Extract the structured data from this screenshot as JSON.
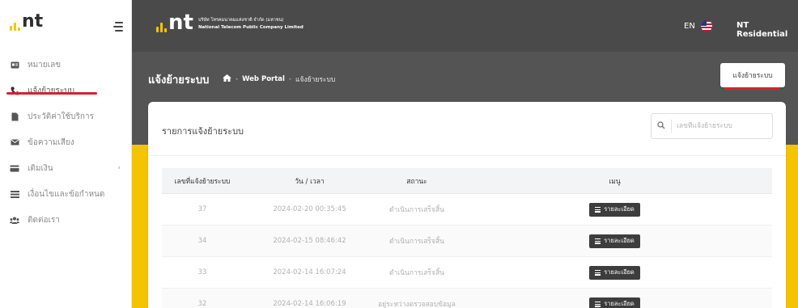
{
  "sidebar": {
    "logo_text": "nt",
    "items": [
      {
        "label": "หมายเลข",
        "icon": "id-card-icon"
      },
      {
        "label": "แจ้งย้ายระบบ",
        "icon": "phone-icon",
        "active": true
      },
      {
        "label": "ประวัติค่าใช้บริการ",
        "icon": "file-icon"
      },
      {
        "label": "ข้อความเสียง",
        "icon": "envelope-icon"
      },
      {
        "label": "เติมเงิน",
        "icon": "credit-card-icon",
        "has_submenu": true
      },
      {
        "label": "เงื่อนไขและข้อกำหนด",
        "icon": "list-icon"
      },
      {
        "label": "ติดต่อเรา",
        "icon": "users-icon"
      }
    ]
  },
  "header": {
    "brand_nt": "nt",
    "brand_th": "บริษัท โทรคมนาคมแห่งชาติ จำกัด (มหาชน)",
    "brand_en": "National Telecom Public Company Limited",
    "lang": "EN",
    "user": "NT Residential"
  },
  "banner": {
    "title": "แจ้งย้ายระบบ",
    "breadcrumb": {
      "sep": "-",
      "portal": "Web Portal",
      "current": "แจ้งย้ายระบบ"
    },
    "action_button": "แจ้งย้ายระบบ"
  },
  "card": {
    "title": "รายการแจ้งย้ายระบบ",
    "search_placeholder": "เลขที่แจ้งย้ายระบบ"
  },
  "table": {
    "headers": [
      "เลขที่แจ้งย้ายระบบ",
      "วัน / เวลา",
      "สถานะ",
      "เมนู"
    ],
    "detail_label": "รายละเอียด",
    "rows": [
      {
        "id": "37",
        "datetime": "2024-02-20 00:35:45",
        "status": "ดำเนินการเสร็จสิ้น"
      },
      {
        "id": "34",
        "datetime": "2024-02-15 08:46:42",
        "status": "ดำเนินการเสร็จสิ้น"
      },
      {
        "id": "33",
        "datetime": "2024-02-14 16:07:24",
        "status": "ดำเนินการเสร็จสิ้น"
      },
      {
        "id": "32",
        "datetime": "2024-02-14 16:06:19",
        "status": "อยู่ระหว่างตรวจสอบข้อมูล"
      }
    ]
  },
  "colors": {
    "accent_yellow": "#f5c400",
    "active_red": "#d4232e",
    "header_gray": "#4a4a4a",
    "banner_gray": "#545454"
  }
}
